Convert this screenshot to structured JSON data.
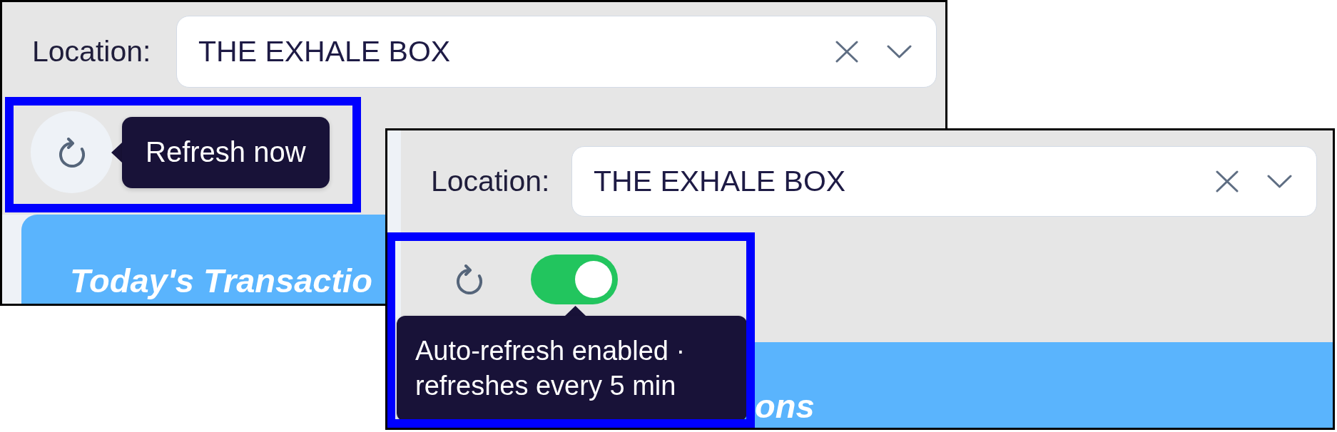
{
  "panels": [
    {
      "location": {
        "label": "Location:",
        "value": "THE EXHALE BOX"
      },
      "refresh_button": {
        "hovered": true
      },
      "tooltip": {
        "kind": "side",
        "text": "Refresh now"
      },
      "card_title": "Today's Transactio"
    },
    {
      "location": {
        "label": "Location:",
        "value": "THE EXHALE BOX"
      },
      "refresh_button": {
        "hovered": false
      },
      "auto_refresh_toggle": {
        "on": true
      },
      "tooltip": {
        "kind": "below",
        "text": "Auto-refresh enabled · refreshes every 5 min"
      },
      "card_title": "ons"
    }
  ]
}
